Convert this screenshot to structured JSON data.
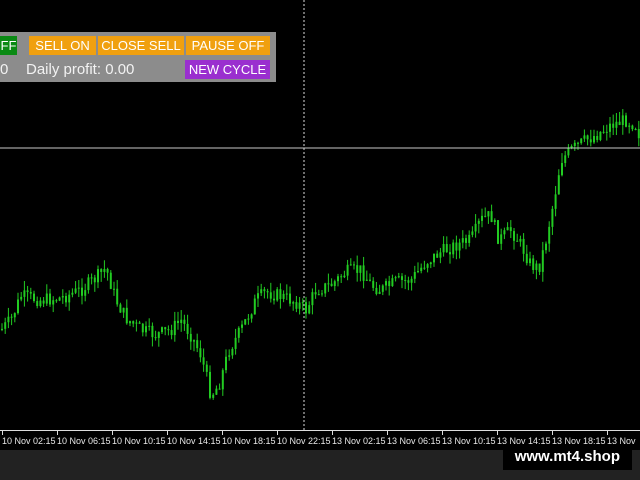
{
  "panel": {
    "buttons": {
      "buy_toggle": "FF",
      "sell_on": "SELL ON",
      "close_sell": "CLOSE SELL",
      "pause_off": "PAUSE OFF",
      "new_cycle": "NEW CYCLE"
    },
    "left_value": "0",
    "daily_profit_label": "Daily profit: 0.00"
  },
  "axis": {
    "time_labels": [
      "10 Nov 02:15",
      "10 Nov 06:15",
      "10 Nov 10:15",
      "10 Nov 14:15",
      "10 Nov 18:15",
      "10 Nov 22:15",
      "13 Nov 02:15",
      "13 Nov 06:15",
      "13 Nov 10:15",
      "13 Nov 14:15",
      "13 Nov 18:15",
      "13 Nov"
    ]
  },
  "watermark": "www.mt4.shop",
  "colors": {
    "background": "#000000",
    "candle": "#22cc22",
    "button_orange": "#f0a010",
    "button_green": "#0a8a14",
    "button_purple": "#9a2fcf",
    "panel": "#8c8c8c",
    "crosshair": "#c8c8c8"
  },
  "chart_data": {
    "type": "candlestick",
    "close_path": [
      [
        0,
        330
      ],
      [
        10,
        320
      ],
      [
        20,
        296
      ],
      [
        40,
        300
      ],
      [
        60,
        298
      ],
      [
        80,
        290
      ],
      [
        95,
        278
      ],
      [
        105,
        268
      ],
      [
        115,
        300
      ],
      [
        125,
        318
      ],
      [
        140,
        330
      ],
      [
        155,
        335
      ],
      [
        170,
        330
      ],
      [
        180,
        320
      ],
      [
        190,
        335
      ],
      [
        200,
        355
      ],
      [
        210,
        395
      ],
      [
        218,
        385
      ],
      [
        228,
        350
      ],
      [
        240,
        330
      ],
      [
        255,
        300
      ],
      [
        265,
        292
      ],
      [
        280,
        296
      ],
      [
        295,
        302
      ],
      [
        305,
        310
      ],
      [
        315,
        290
      ],
      [
        330,
        285
      ],
      [
        345,
        272
      ],
      [
        360,
        270
      ],
      [
        370,
        285
      ],
      [
        380,
        290
      ],
      [
        395,
        282
      ],
      [
        410,
        280
      ],
      [
        425,
        262
      ],
      [
        440,
        252
      ],
      [
        455,
        245
      ],
      [
        470,
        240
      ],
      [
        480,
        220
      ],
      [
        490,
        215
      ],
      [
        498,
        240
      ],
      [
        510,
        230
      ],
      [
        520,
        245
      ],
      [
        530,
        265
      ],
      [
        538,
        268
      ],
      [
        545,
        240
      ],
      [
        553,
        200
      ],
      [
        560,
        160
      ],
      [
        570,
        150
      ],
      [
        585,
        140
      ],
      [
        595,
        135
      ],
      [
        610,
        125
      ],
      [
        625,
        120
      ],
      [
        635,
        125
      ],
      [
        640,
        140
      ]
    ]
  }
}
